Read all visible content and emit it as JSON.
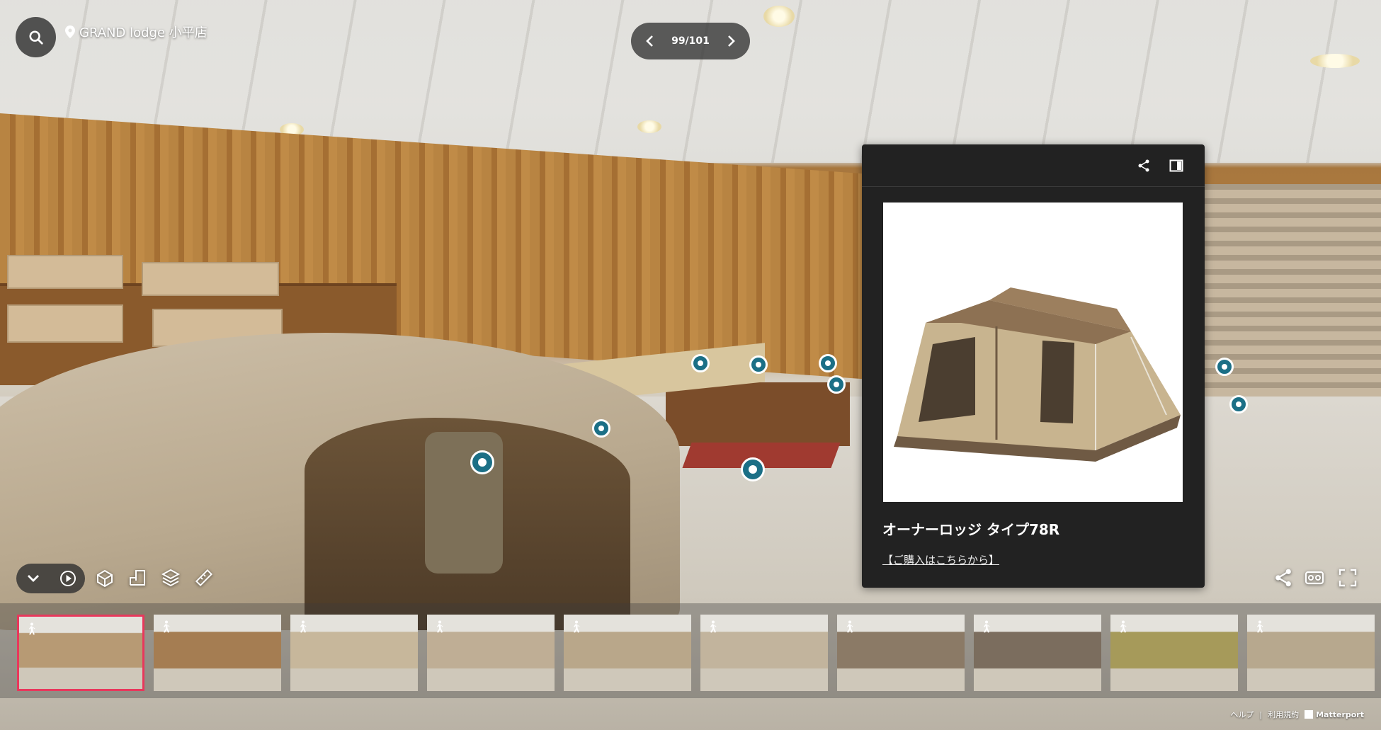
{
  "location": {
    "name": "GRAND lodge 小平店"
  },
  "pager": {
    "text": "99/101"
  },
  "panel": {
    "title": "オーナーロッジ タイプ78R",
    "link": "【ご購入はこちらから】"
  },
  "footer": {
    "help": "ヘルプ",
    "separator": "|",
    "terms": "利用規約",
    "brand": "Matterport"
  },
  "thumbnails": [
    {
      "bg": "#b79a74",
      "active": true
    },
    {
      "bg": "#a57d52",
      "active": false
    },
    {
      "bg": "#c7b79b",
      "active": false
    },
    {
      "bg": "#bfae95",
      "active": false
    },
    {
      "bg": "#b9a78a",
      "active": false
    },
    {
      "bg": "#c2b49d",
      "active": false
    },
    {
      "bg": "#8b7a66",
      "active": false
    },
    {
      "bg": "#7b6d5e",
      "active": false
    },
    {
      "bg": "#a69a5a",
      "active": false
    },
    {
      "bg": "#b7a88e",
      "active": false
    }
  ],
  "colors": {
    "accent": "#e8385c",
    "hotspot": "#1b6f86",
    "panel_bg": "#222222"
  }
}
